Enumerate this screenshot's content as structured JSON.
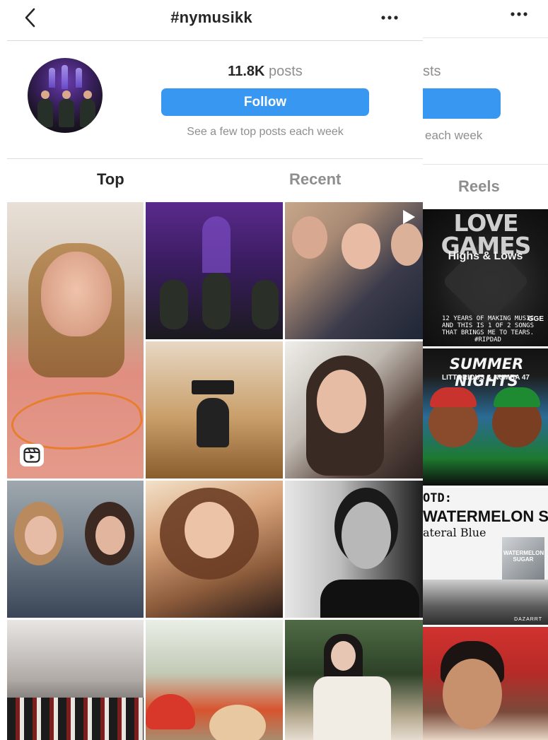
{
  "header": {
    "title": "#nymusikk"
  },
  "profile": {
    "posts_count": "11.8K",
    "posts_label": "posts",
    "follow_label": "Follow",
    "subtitle": "See a few top posts each week"
  },
  "tabs": [
    {
      "label": "Top",
      "active": true
    },
    {
      "label": "Recent",
      "active": false
    }
  ],
  "side": {
    "posts_fragment": "sts",
    "subtitle_fragment": "each week",
    "tab_label": "Reels",
    "tiles": [
      {
        "title": "LOVE GAMES",
        "subtitle": "Highs & Lows",
        "caption": "12 YEARS OF MAKING MUSIC AND THIS IS 1 OF 2 SONGS THAT BRINGS ME TO TEARS. #RIPDAD",
        "logo": "GGE"
      },
      {
        "title": "SUMMER NIGHTS",
        "subtitle": "LITTORIOUS & NUMBA 47"
      },
      {
        "otd": "OTD:",
        "title": "WATERMELON SUGAR",
        "artist": "ateral Blue",
        "cover_text": "WATERMELON SUGAR",
        "credit": "DAZARRT"
      }
    ]
  },
  "colors": {
    "accent": "#3897f0",
    "text_primary": "#262626",
    "text_secondary": "#8e8e8e",
    "divider": "#dbdbdb"
  },
  "icons": {
    "back": "chevron-left-icon",
    "more": "more-horizontal-icon",
    "reels": "reels-icon",
    "play": "play-icon"
  }
}
